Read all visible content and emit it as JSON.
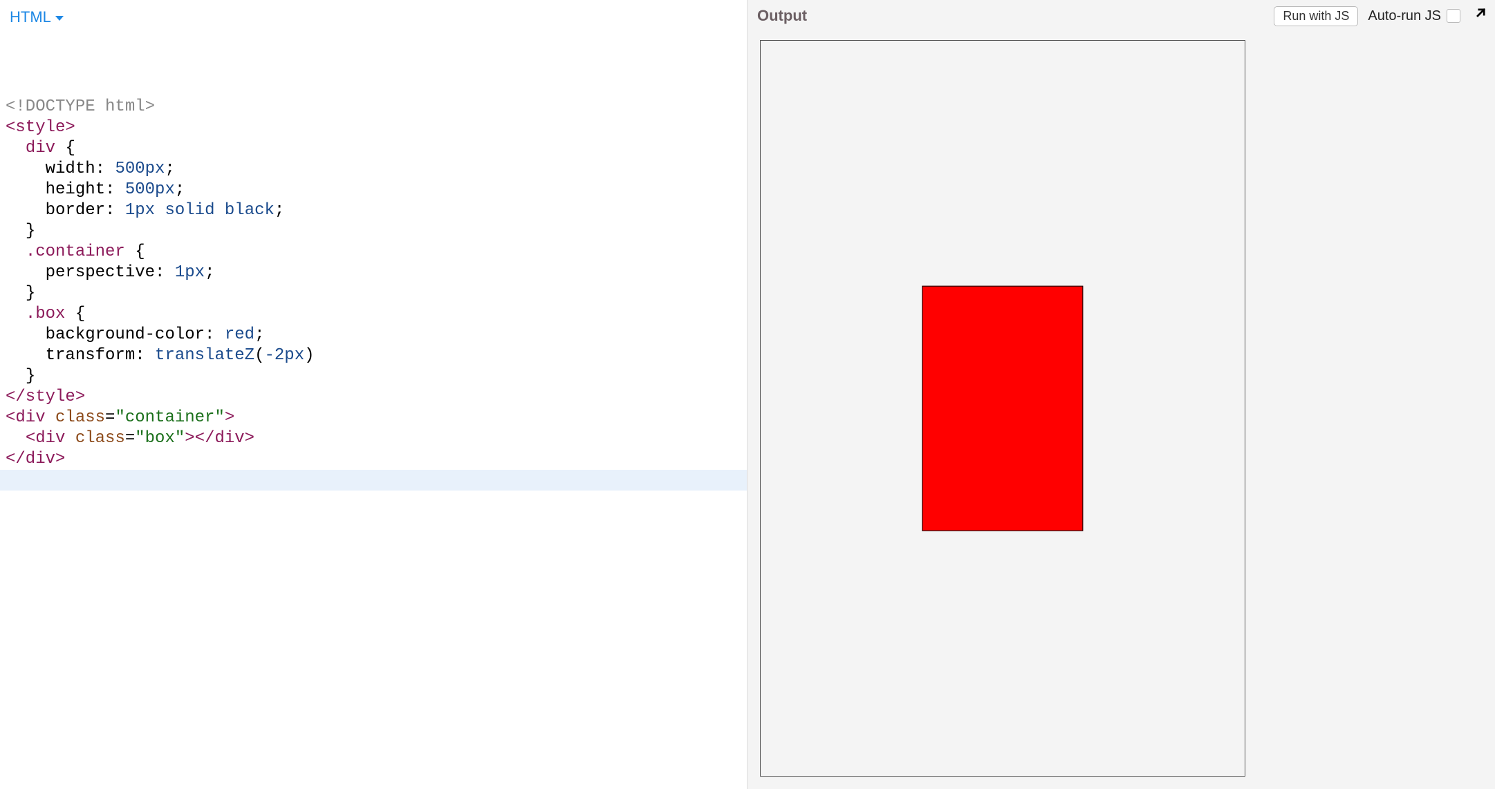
{
  "left": {
    "language_label": "HTML",
    "code_tokens": [
      [
        [
          "doctype",
          "<!DOCTYPE html>"
        ]
      ],
      [
        [
          "tag",
          "<style>"
        ]
      ],
      [
        [
          "plain",
          "  "
        ],
        [
          "selector",
          "div"
        ],
        [
          "plain",
          " "
        ],
        [
          "punc",
          "{"
        ]
      ],
      [
        [
          "plain",
          "    "
        ],
        [
          "prop",
          "width"
        ],
        [
          "punc",
          ":"
        ],
        [
          "plain",
          " "
        ],
        [
          "num",
          "500px"
        ],
        [
          "punc",
          ";"
        ]
      ],
      [
        [
          "plain",
          "    "
        ],
        [
          "prop",
          "height"
        ],
        [
          "punc",
          ":"
        ],
        [
          "plain",
          " "
        ],
        [
          "num",
          "500px"
        ],
        [
          "punc",
          ";"
        ]
      ],
      [
        [
          "plain",
          "    "
        ],
        [
          "prop",
          "border"
        ],
        [
          "punc",
          ":"
        ],
        [
          "plain",
          " "
        ],
        [
          "num",
          "1px"
        ],
        [
          "plain",
          " "
        ],
        [
          "kw",
          "solid"
        ],
        [
          "plain",
          " "
        ],
        [
          "kw",
          "black"
        ],
        [
          "punc",
          ";"
        ]
      ],
      [
        [
          "plain",
          "  "
        ],
        [
          "punc",
          "}"
        ]
      ],
      [
        [
          "plain",
          ""
        ]
      ],
      [
        [
          "plain",
          "  "
        ],
        [
          "selector",
          ".container"
        ],
        [
          "plain",
          " "
        ],
        [
          "punc",
          "{"
        ]
      ],
      [
        [
          "plain",
          "    "
        ],
        [
          "prop",
          "perspective"
        ],
        [
          "punc",
          ":"
        ],
        [
          "plain",
          " "
        ],
        [
          "num",
          "1px"
        ],
        [
          "punc",
          ";"
        ]
      ],
      [
        [
          "plain",
          "  "
        ],
        [
          "punc",
          "}"
        ]
      ],
      [
        [
          "plain",
          ""
        ]
      ],
      [
        [
          "plain",
          "  "
        ],
        [
          "selector",
          ".box"
        ],
        [
          "plain",
          " "
        ],
        [
          "punc",
          "{"
        ]
      ],
      [
        [
          "plain",
          "    "
        ],
        [
          "prop",
          "background-color"
        ],
        [
          "punc",
          ":"
        ],
        [
          "plain",
          " "
        ],
        [
          "kw",
          "red"
        ],
        [
          "punc",
          ";"
        ]
      ],
      [
        [
          "plain",
          "    "
        ],
        [
          "prop",
          "transform"
        ],
        [
          "punc",
          ":"
        ],
        [
          "plain",
          " "
        ],
        [
          "kw",
          "translateZ"
        ],
        [
          "punc",
          "("
        ],
        [
          "num",
          "-2px"
        ],
        [
          "punc",
          ")"
        ]
      ],
      [
        [
          "plain",
          "  "
        ],
        [
          "punc",
          "}"
        ]
      ],
      [
        [
          "tag",
          "</style>"
        ]
      ],
      [
        [
          "plain",
          ""
        ]
      ],
      [
        [
          "tag",
          "<div"
        ],
        [
          "plain",
          " "
        ],
        [
          "attr",
          "class"
        ],
        [
          "punc",
          "="
        ],
        [
          "string",
          "\"container\""
        ],
        [
          "tag",
          ">"
        ]
      ],
      [
        [
          "plain",
          "  "
        ],
        [
          "tag",
          "<div"
        ],
        [
          "plain",
          " "
        ],
        [
          "attr",
          "class"
        ],
        [
          "punc",
          "="
        ],
        [
          "string",
          "\"box\""
        ],
        [
          "tag",
          ">"
        ],
        [
          "tag",
          "</div>"
        ]
      ],
      [
        [
          "tag",
          "</div>"
        ]
      ],
      [
        [
          "plain",
          ""
        ]
      ]
    ],
    "highlight_line_index": 21
  },
  "right": {
    "title": "Output",
    "run_button": "Run with JS",
    "autorun_label": "Auto-run JS",
    "autorun_checked": false,
    "render": {
      "container_border": "1px solid black",
      "box_color": "red"
    }
  }
}
